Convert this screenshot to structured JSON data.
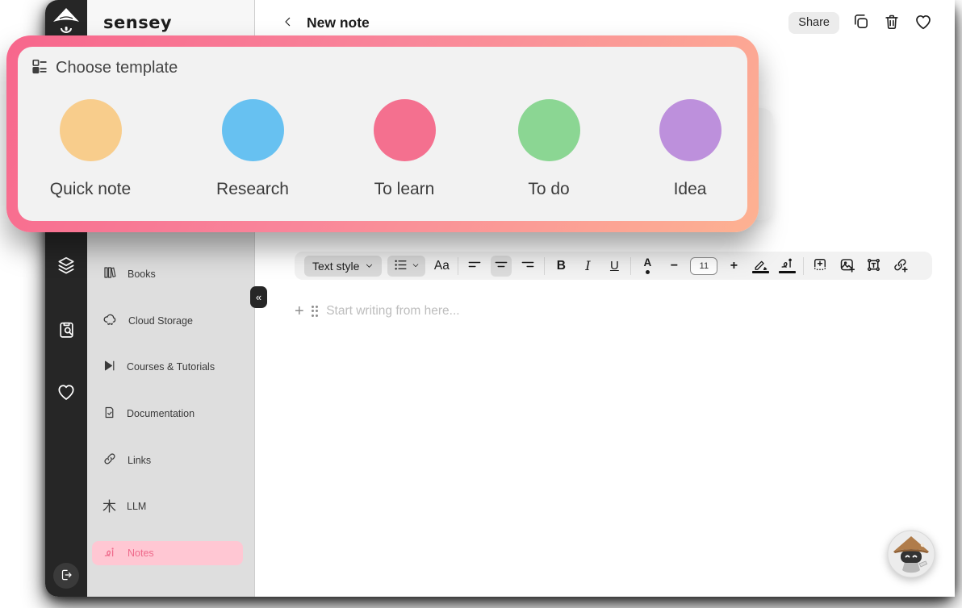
{
  "brand": {
    "wordmark": "sensey"
  },
  "header": {
    "title": "New note",
    "share_label": "Share"
  },
  "modal": {
    "title": "Choose template",
    "border_gradient_start": "#F7668C",
    "border_gradient_end": "#FDB292",
    "templates": [
      {
        "label": "Quick note",
        "color": "#F8CD8C"
      },
      {
        "label": "Research",
        "color": "#67C1F1"
      },
      {
        "label": "To learn",
        "color": "#F4708F"
      },
      {
        "label": "To do",
        "color": "#8BD693"
      },
      {
        "label": "Idea",
        "color": "#BD90DC"
      }
    ]
  },
  "sidebar": {
    "collapse_glyph": "«",
    "items": [
      {
        "label": "Books"
      },
      {
        "label": "Cloud Storage"
      },
      {
        "label": "Courses & Tutorials"
      },
      {
        "label": "Documentation"
      },
      {
        "label": "Links"
      },
      {
        "label": "LLM",
        "icon_glyph": "木"
      },
      {
        "label": "Notes"
      }
    ],
    "active_item": "Notes",
    "active_bg": "#FFC7D3",
    "active_color": "#EF6A8B"
  },
  "toolbar": {
    "text_style_label": "Text style",
    "font_label": "Aa",
    "bold_label": "B",
    "italic_label": "I",
    "underline_label": "U",
    "text_color_label": "A",
    "decrease_label": "−",
    "font_size_value": "11",
    "increase_label": "+"
  },
  "editor": {
    "add_glyph": "+",
    "placeholder": "Start writing from here..."
  }
}
